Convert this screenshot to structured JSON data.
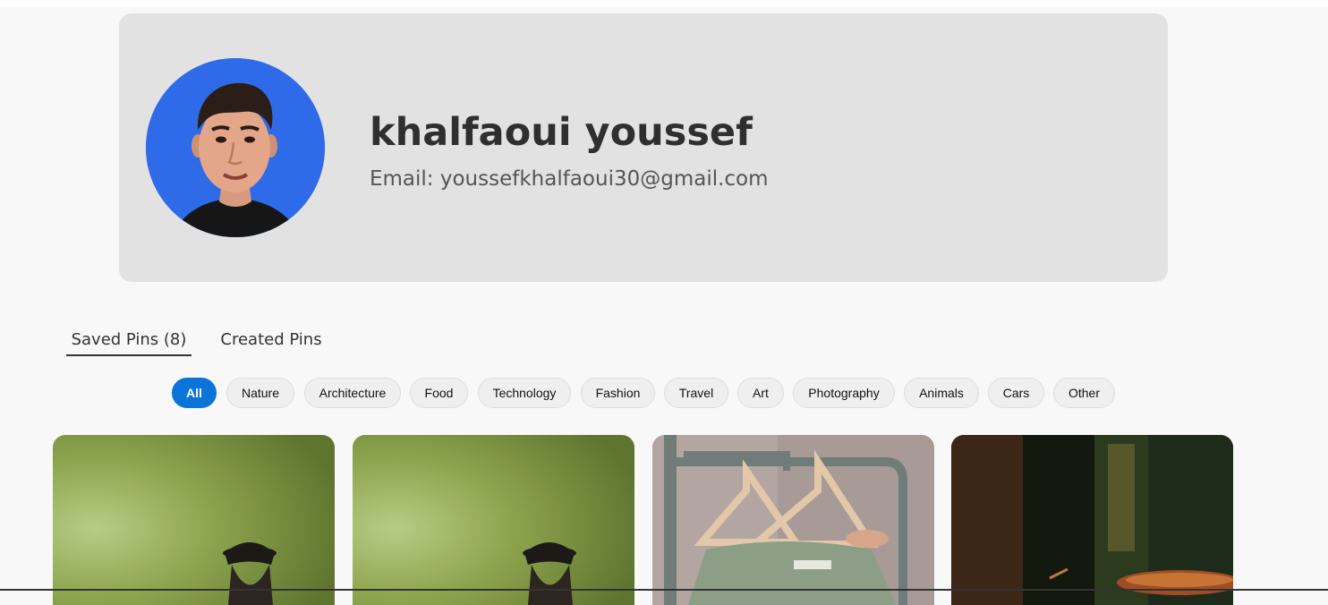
{
  "profile": {
    "name": "khalfaoui youssef",
    "email": "Email: youssefkhalfaoui30@gmail.com",
    "avatar_bg": "#2f6be8"
  },
  "tabs": [
    {
      "label": "Saved Pins (8)",
      "active": true
    },
    {
      "label": "Created Pins",
      "active": false
    }
  ],
  "filters": [
    {
      "label": "All",
      "active": true
    },
    {
      "label": "Nature"
    },
    {
      "label": "Architecture"
    },
    {
      "label": "Food"
    },
    {
      "label": "Technology"
    },
    {
      "label": "Fashion"
    },
    {
      "label": "Travel"
    },
    {
      "label": "Art"
    },
    {
      "label": "Photography"
    },
    {
      "label": "Animals"
    },
    {
      "label": "Cars"
    },
    {
      "label": "Other"
    }
  ],
  "pins": [
    {
      "image": "person-in-hat-green-backdrop"
    },
    {
      "image": "person-in-hat-green-backdrop"
    },
    {
      "image": "clothes-on-hanger-rack"
    },
    {
      "image": "dark-food-scene"
    }
  ],
  "colors": {
    "accent": "#0b74d8",
    "card_bg": "#e2e2e2",
    "page_bg": "#f8f8f8"
  }
}
